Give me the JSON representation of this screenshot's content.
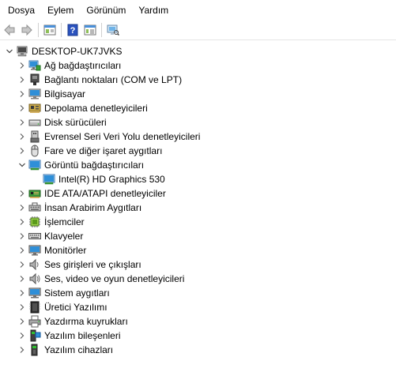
{
  "menu": {
    "items": [
      "Dosya",
      "Eylem",
      "Görünüm",
      "Yardım"
    ]
  },
  "tree": {
    "root": "DESKTOP-UK7JVKS",
    "categories": [
      {
        "label": "Ağ bağdaştırıcıları",
        "icon": "network-adapter-icon",
        "expanded": false
      },
      {
        "label": "Bağlantı noktaları (COM ve LPT)",
        "icon": "port-icon",
        "expanded": false
      },
      {
        "label": "Bilgisayar",
        "icon": "computer-icon",
        "expanded": false
      },
      {
        "label": "Depolama denetleyicileri",
        "icon": "storage-controller-icon",
        "expanded": false
      },
      {
        "label": "Disk sürücüleri",
        "icon": "disk-drive-icon",
        "expanded": false
      },
      {
        "label": "Evrensel Seri Veri Yolu denetleyicileri",
        "icon": "usb-controller-icon",
        "expanded": false
      },
      {
        "label": "Fare ve diğer işaret aygıtları",
        "icon": "mouse-icon",
        "expanded": false
      },
      {
        "label": "Görüntü bağdaştırıcıları",
        "icon": "display-adapter-icon",
        "expanded": true
      },
      {
        "label": "IDE ATA/ATAPI denetleyiciler",
        "icon": "ide-controller-icon",
        "expanded": false
      },
      {
        "label": "İnsan Arabirim Aygıtları",
        "icon": "hid-icon",
        "expanded": false
      },
      {
        "label": "İşlemciler",
        "icon": "processor-icon",
        "expanded": false
      },
      {
        "label": "Klavyeler",
        "icon": "keyboard-icon",
        "expanded": false
      },
      {
        "label": "Monitörler",
        "icon": "monitor-icon",
        "expanded": false
      },
      {
        "label": "Ses girişleri ve çıkışları",
        "icon": "speaker-icon",
        "expanded": false
      },
      {
        "label": "Ses, video ve oyun denetleyicileri",
        "icon": "sound-video-icon",
        "expanded": false
      },
      {
        "label": "Sistem aygıtları",
        "icon": "system-device-icon",
        "expanded": false
      },
      {
        "label": "Üretici Yazılımı",
        "icon": "firmware-icon",
        "expanded": false
      },
      {
        "label": "Yazdırma kuyrukları",
        "icon": "printer-icon",
        "expanded": false
      },
      {
        "label": "Yazılım bileşenleri",
        "icon": "software-component-icon",
        "expanded": false
      },
      {
        "label": "Yazılım cihazları",
        "icon": "software-device-icon",
        "expanded": false
      }
    ],
    "display_child": "Intel(R) HD Graphics 530"
  },
  "colors": {
    "accent_blue": "#2b7cd3",
    "expander_gray": "#606060"
  }
}
